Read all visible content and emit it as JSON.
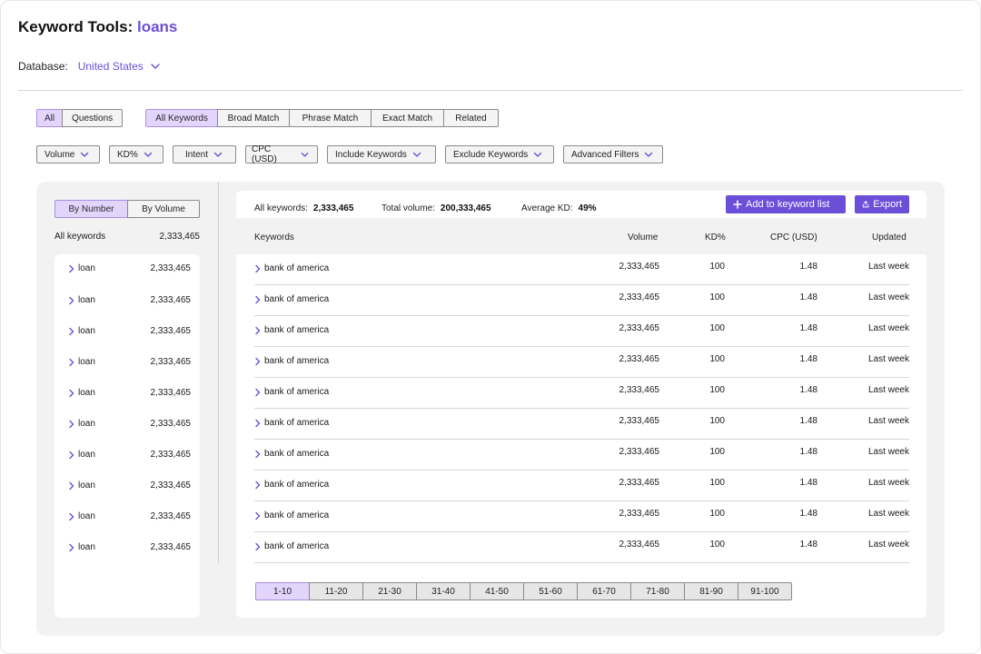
{
  "header": {
    "title_prefix": "Keyword Tools:",
    "title_keyword": "loans",
    "database_label": "Database:",
    "database_value": "United States"
  },
  "type_toggle": [
    {
      "label": "All",
      "active": true
    },
    {
      "label": "Questions",
      "active": false
    }
  ],
  "match_toggle": [
    {
      "label": "All Keywords",
      "active": true
    },
    {
      "label": "Broad Match",
      "active": false
    },
    {
      "label": "Phrase Match",
      "active": false
    },
    {
      "label": "Exact Match",
      "active": false
    },
    {
      "label": "Related",
      "active": false
    }
  ],
  "filters": [
    "Volume",
    "KD%",
    "Intent",
    "CPC (USD)",
    "Include Keywords",
    "Exclude Keywords",
    "Advanced Filters"
  ],
  "sidebar": {
    "toggle": [
      {
        "label": "By Number",
        "active": true
      },
      {
        "label": "By Volume",
        "active": false
      }
    ],
    "total_label": "All keywords",
    "total_value": "2,333,465",
    "groups": [
      {
        "label": "loan",
        "value": "2,333,465"
      },
      {
        "label": "loan",
        "value": "2,333,465"
      },
      {
        "label": "loan",
        "value": "2,333,465"
      },
      {
        "label": "loan",
        "value": "2,333,465"
      },
      {
        "label": "loan",
        "value": "2,333,465"
      },
      {
        "label": "loan",
        "value": "2,333,465"
      },
      {
        "label": "loan",
        "value": "2,333,465"
      },
      {
        "label": "loan",
        "value": "2,333,465"
      },
      {
        "label": "loan",
        "value": "2,333,465"
      },
      {
        "label": "loan",
        "value": "2,333,465"
      }
    ]
  },
  "summary": {
    "all_keywords_label": "All keywords:",
    "all_keywords_value": "2,333,465",
    "total_volume_label": "Total volume:",
    "total_volume_value": "200,333,465",
    "avg_kd_label": "Average KD:",
    "avg_kd_value": "49%"
  },
  "actions": {
    "add_label": "Add to keyword list",
    "export_label": "Export"
  },
  "table": {
    "headers": {
      "keyword": "Keywords",
      "volume": "Volume",
      "kd": "KD%",
      "cpc": "CPC (USD)",
      "updated": "Updated"
    },
    "rows": [
      {
        "keyword": "bank of america",
        "volume": "2,333,465",
        "kd": "100",
        "cpc": "1.48",
        "updated": "Last week"
      },
      {
        "keyword": "bank of america",
        "volume": "2,333,465",
        "kd": "100",
        "cpc": "1.48",
        "updated": "Last week"
      },
      {
        "keyword": "bank of america",
        "volume": "2,333,465",
        "kd": "100",
        "cpc": "1.48",
        "updated": "Last week"
      },
      {
        "keyword": "bank of america",
        "volume": "2,333,465",
        "kd": "100",
        "cpc": "1.48",
        "updated": "Last week"
      },
      {
        "keyword": "bank of america",
        "volume": "2,333,465",
        "kd": "100",
        "cpc": "1.48",
        "updated": "Last week"
      },
      {
        "keyword": "bank of america",
        "volume": "2,333,465",
        "kd": "100",
        "cpc": "1.48",
        "updated": "Last week"
      },
      {
        "keyword": "bank of america",
        "volume": "2,333,465",
        "kd": "100",
        "cpc": "1.48",
        "updated": "Last week"
      },
      {
        "keyword": "bank of america",
        "volume": "2,333,465",
        "kd": "100",
        "cpc": "1.48",
        "updated": "Last week"
      },
      {
        "keyword": "bank of america",
        "volume": "2,333,465",
        "kd": "100",
        "cpc": "1.48",
        "updated": "Last week"
      },
      {
        "keyword": "bank of america",
        "volume": "2,333,465",
        "kd": "100",
        "cpc": "1.48",
        "updated": "Last week"
      }
    ]
  },
  "pagination": [
    {
      "label": "1-10",
      "active": true
    },
    {
      "label": "11-20",
      "active": false
    },
    {
      "label": "21-30",
      "active": false
    },
    {
      "label": "31-40",
      "active": false
    },
    {
      "label": "41-50",
      "active": false
    },
    {
      "label": "51-60",
      "active": false
    },
    {
      "label": "61-70",
      "active": false
    },
    {
      "label": "71-80",
      "active": false
    },
    {
      "label": "81-90",
      "active": false
    },
    {
      "label": "91-100",
      "active": false
    }
  ],
  "colors": {
    "accent": "#6b4fd8",
    "active_toggle": "#e2d4fb",
    "panel_bg": "#f2f2f2"
  }
}
